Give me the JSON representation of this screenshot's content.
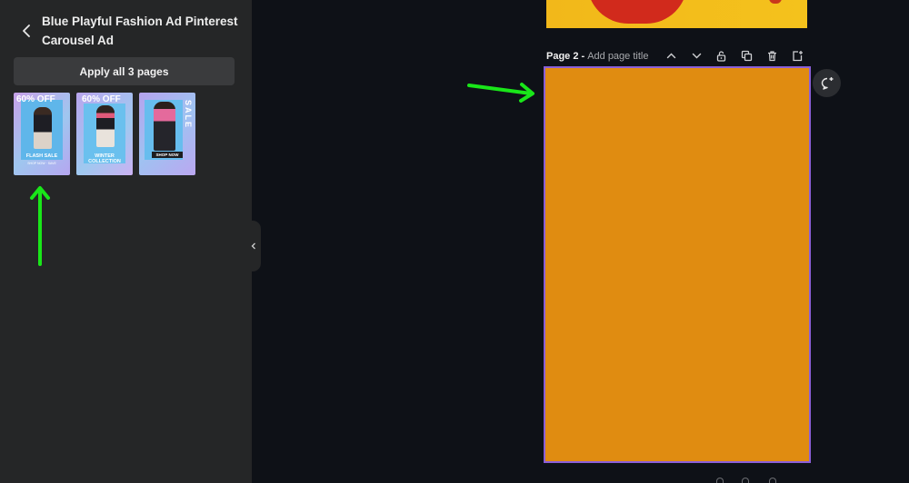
{
  "panel": {
    "template_title": "Blue Playful Fashion Ad Pinterest Carousel Ad",
    "apply_button": "Apply all 3 pages",
    "thumbnails": [
      {
        "headline": "60% OFF",
        "caption": "FLASH SALE",
        "subcaption": "SHOP NOW · SAVE"
      },
      {
        "headline": "60% OFF",
        "caption": "WINTER COLLECTION",
        "subcaption": ""
      },
      {
        "headline": "SALE",
        "caption": "SHOP NOW",
        "subcaption": ""
      }
    ]
  },
  "canvas": {
    "page_label": "Page 2 -",
    "page_title_placeholder": "Add page title",
    "page_fill_color": "#e08c11",
    "page_border_color": "#8b5fd8",
    "tools": [
      "chevron-up-icon",
      "chevron-down-icon",
      "unlock-icon",
      "duplicate-icon",
      "trash-icon",
      "add-page-icon"
    ]
  },
  "annotations": {
    "arrow_color": "#19e619"
  }
}
